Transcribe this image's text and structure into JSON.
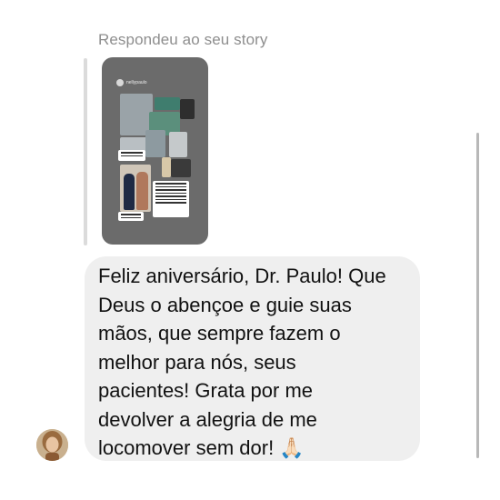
{
  "reply": {
    "header": "Respondeu ao seu story",
    "story_username": "nellypaulo"
  },
  "message": {
    "lines": [
      "Feliz aniversário, Dr. Paulo! Que",
      "Deus o abençoe e guie suas",
      "mãos, que sempre fazem o",
      "melhor para nós, seus",
      "pacientes! Grata por me",
      "devolver a alegria de me",
      "locomover sem dor! 🙏🏻"
    ]
  },
  "colors": {
    "header_text": "#8e8e8e",
    "bubble_bg": "#efefef",
    "message_text": "#111111",
    "story_bg": "#6b6b6b"
  },
  "icons": [
    "profile-avatar",
    "story-thumbnail"
  ]
}
